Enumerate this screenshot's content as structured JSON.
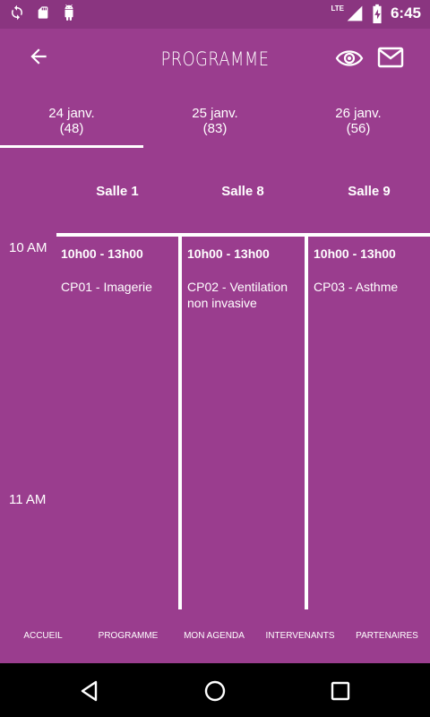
{
  "status_bar": {
    "time": "6:45",
    "network": "LTE",
    "icons": [
      "sync-icon",
      "sd-card-icon",
      "android-icon",
      "signal-icon",
      "battery-charging-icon"
    ]
  },
  "app_bar": {
    "title": "PROGRAMME",
    "back_icon": "arrow-left-icon",
    "eye_icon": "eye-icon",
    "mail_icon": "mail-icon"
  },
  "day_tabs": [
    {
      "date": "24 janv.",
      "count": "(48)",
      "selected": true
    },
    {
      "date": "25 janv.",
      "count": "(83)",
      "selected": false
    },
    {
      "date": "26 janv.",
      "count": "(56)",
      "selected": false
    }
  ],
  "rooms": [
    "Salle 1",
    "Salle 8",
    "Salle 9"
  ],
  "time_labels": [
    "10 AM",
    "11 AM"
  ],
  "events": [
    {
      "time": "10h00 - 13h00",
      "name": "CP01 - Imagerie"
    },
    {
      "time": "10h00 - 13h00",
      "name": "CP02 - Ventilation non invasive"
    },
    {
      "time": "10h00 - 13h00",
      "name": "CP03 - Asthme"
    }
  ],
  "bottom_nav": [
    "ACCUEIL",
    "PROGRAMME",
    "MON AGENDA",
    "INTERVENANTS",
    "PARTENAIRES"
  ],
  "colors": {
    "background": "#9a3d8e",
    "status_bar": "#8a3580",
    "divider": "#ffffff"
  }
}
